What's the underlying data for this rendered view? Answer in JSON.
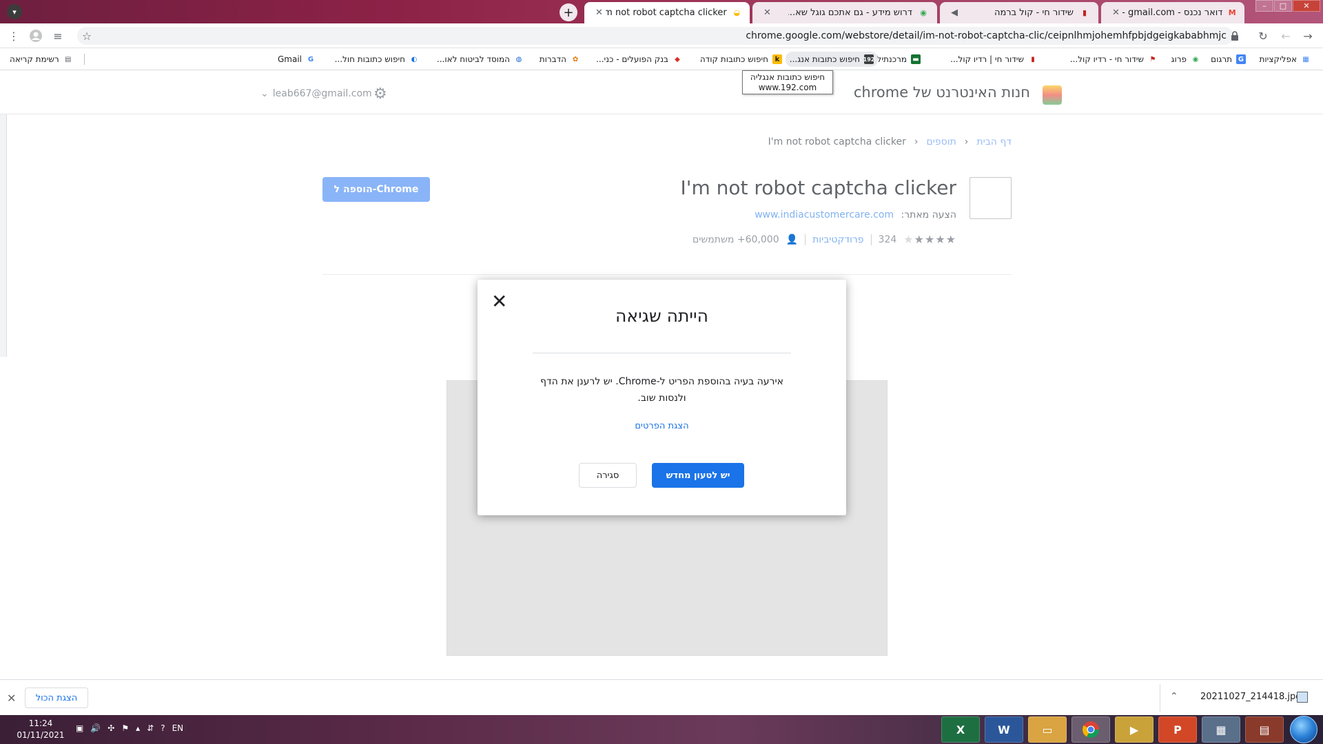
{
  "tabs": [
    {
      "title": "דואר נכנס - Gmail - gmail.com@",
      "state": "inactive",
      "favicon": "gmail-icon"
    },
    {
      "title": "שידור חי - קול ברמה",
      "state": "inactive",
      "favicon": "bar-chart-icon"
    },
    {
      "title": "דרוש מידע - גם אתכם גוגל שא...",
      "state": "inactive",
      "favicon": "green-logo-icon"
    },
    {
      "title": "I'm not robot captcha clicker - ...",
      "state": "active",
      "favicon": "webstore-icon"
    }
  ],
  "toolbar": {
    "url": "chrome.google.com/webstore/detail/im-not-robot-captcha-clic/ceipnlhmjohemhfpbjdgeigkababhmjc"
  },
  "bookmarks": [
    "אפליקציות",
    "תרגום",
    "פרוג",
    "שידור חי - רדיו קול...",
    "שידור חי | רדיו קול...",
    "מרכנתיל",
    "חיפוש כתובות אנג...",
    "חיפוש כתובות קודה",
    "בנק הפועלים - כני...",
    "הדברות",
    "המוסד לביטוח לאו...",
    "חיפוש כתובות חול...",
    "Gmail"
  ],
  "reading_list": "רשימת קריאה",
  "tooltip": {
    "line1": "חיפוש כתובות אנגליה",
    "line2": "www.192.com"
  },
  "webstore": {
    "store_title": "חנות האינטרנט של chrome",
    "account": "leab667@gmail.com",
    "breadcrumb": [
      "דף הבית",
      "תוספים",
      "I'm not robot captcha clicker"
    ],
    "item_title": "I'm not robot captcha clicker",
    "offered_by_label": "הצעה מאתר:",
    "offered_by_site": "www.indiacustomercare.com",
    "rating": 3,
    "rating_count": "324",
    "category": "פרודקטיביות",
    "users": "60,000+ משתמשים",
    "add_button": "הוספה ל-Chrome"
  },
  "dialog": {
    "title": "הייתה שגיאה",
    "message": "אירעה בעיה בהוספת הפריט ל-Chrome. יש לרענן את הדף ולנסות שוב.",
    "details_link": "הצגת הפרטים",
    "reload_button": "יש לטעון מחדש",
    "close_button": "סגירה"
  },
  "download_shelf": {
    "file_name": "20211027_214418.jpg",
    "show_all": "הצגת הכול"
  },
  "taskbar": {
    "time": "11:24",
    "date": "01/11/2021",
    "language": "EN"
  },
  "colors": {
    "primary_blue": "#1a73e8",
    "disabled_blue": "#8ab4f8",
    "tabstrip": "#8d2247"
  }
}
